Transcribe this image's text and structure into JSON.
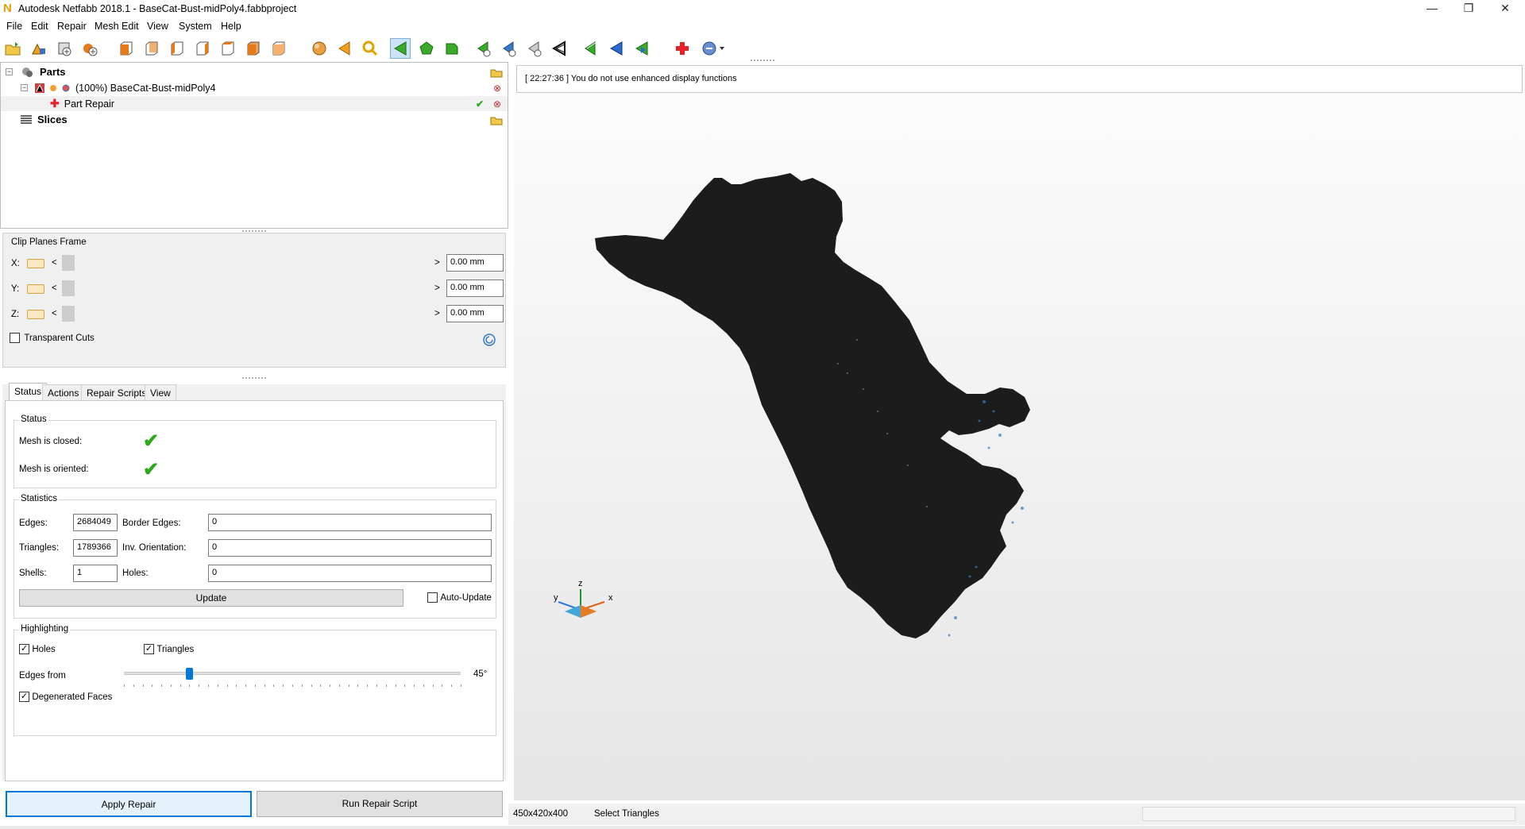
{
  "window": {
    "title": "Autodesk Netfabb 2018.1 - BaseCat-Bust-midPoly4.fabbproject",
    "logo_letter": "N",
    "minimize_glyph": "—",
    "restore_glyph": "❐",
    "close_glyph": "✕"
  },
  "menu": [
    "File",
    "Edit",
    "Repair",
    "Mesh Edit",
    "View",
    "System",
    "Help"
  ],
  "toolbar_icons": [
    "open-folder-icon",
    "add-part-icon",
    "add-part-from-disk-icon",
    "add-slice-icon",
    "view-front-icon",
    "view-back-icon",
    "view-left-icon",
    "view-right-icon",
    "view-top-icon",
    "view-bottom-icon",
    "view-iso-icon",
    "sphere-icon",
    "arrow-left-orange-icon",
    "zoom-icon",
    "select-triangles-icon",
    "select-surface-icon",
    "select-shell-icon",
    "cut-icon",
    "add-triangle-icon",
    "remove-triangle-icon",
    "wireframe-icon",
    "undo-green-icon",
    "select-blue-icon",
    "invert-selection-icon",
    "repair-cross-icon",
    "help-dropdown-icon"
  ],
  "tree": {
    "parts_label": "Parts",
    "part_label": "(100%) BaseCat-Bust-midPoly4",
    "repair_label": "Part Repair",
    "slices_label": "Slices",
    "collapse_glyph": "−"
  },
  "clip": {
    "title": "Clip Planes Frame",
    "rows": [
      {
        "axis": "X:",
        "value": "0.00 mm"
      },
      {
        "axis": "Y:",
        "value": "0.00 mm"
      },
      {
        "axis": "Z:",
        "value": "0.00 mm"
      }
    ],
    "left_arrow": "<",
    "right_arrow": ">",
    "transparent_label": "Transparent Cuts",
    "transparent_checked": false
  },
  "tabs": [
    "Status",
    "Actions",
    "Repair Scripts",
    "View"
  ],
  "active_tab": "Status",
  "status": {
    "title": "Status",
    "closed_label": "Mesh is closed:",
    "oriented_label": "Mesh is oriented:",
    "check_glyph": "✔"
  },
  "statistics": {
    "title": "Statistics",
    "edges_label": "Edges:",
    "edges": "2684049",
    "border_edges_label": "Border Edges:",
    "border_edges": "0",
    "triangles_label": "Triangles:",
    "triangles": "1789366",
    "inv_orientation_label": "Inv. Orientation:",
    "inv_orientation": "0",
    "shells_label": "Shells:",
    "shells": "1",
    "holes_label": "Holes:",
    "holes": "0",
    "update_label": "Update",
    "auto_update_label": "Auto-Update",
    "auto_update_checked": false
  },
  "highlighting": {
    "title": "Highlighting",
    "holes_label": "Holes",
    "holes_checked": true,
    "triangles_label": "Triangles",
    "triangles_checked": true,
    "edges_from_label": "Edges from",
    "edges_from_value": "45°",
    "edges_from_fraction": 0.19,
    "degenerated_label": "Degenerated Faces",
    "degenerated_checked": true,
    "check_mark": "✓"
  },
  "buttons": {
    "apply_repair": "Apply Repair",
    "run_script": "Run Repair Script"
  },
  "viewport": {
    "message": "[ 22:27:36 ] You do not use enhanced display functions",
    "axis_x": "x",
    "axis_y": "y",
    "axis_z": "z"
  },
  "statusbar": {
    "dimensions": "450x420x400",
    "mode": "Select Triangles"
  },
  "colors": {
    "model": "#1c1c1c",
    "check_green": "#2fa81f",
    "accent_blue": "#0078d7",
    "repair_red": "#e0242a"
  }
}
